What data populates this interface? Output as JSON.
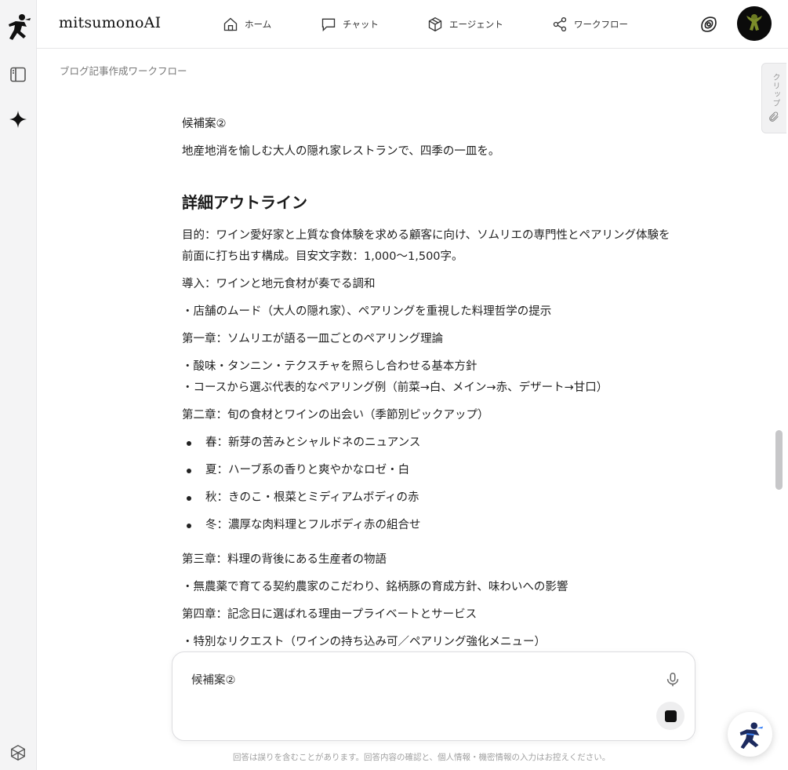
{
  "header": {
    "brand": "mitsumonoAI",
    "nav": [
      {
        "label": "ホーム",
        "icon": "home-icon"
      },
      {
        "label": "チャット",
        "icon": "chat-icon"
      },
      {
        "label": "エージェント",
        "icon": "box-icon"
      },
      {
        "label": "ワークフロー",
        "icon": "share-icon"
      }
    ]
  },
  "breadcrumb": "ブログ記事作成ワークフロー",
  "clip_tab": "クリップ",
  "content": {
    "candidate_label": "候補案②",
    "candidate_text": "地産地消を愉しむ大人の隠れ家レストランで、四季の一皿を。",
    "heading": "詳細アウトライン",
    "purpose_line1": "目的：ワイン愛好家と上質な食体験を求める顧客に向け、ソムリエの専門性とペアリング体験を",
    "purpose_line2": "前面に打ち出す構成。目安文字数：1,000〜1,500字。",
    "intro": "導入：ワインと地元食材が奏でる調和",
    "intro_item": "・店舗のムード（大人の隠れ家）、ペアリングを重視した料理哲学の提示",
    "ch1": "第一章：ソムリエが語る一皿ごとのペアリング理論",
    "ch1_item1": "・酸味・タンニン・テクスチャを照らし合わせる基本方針",
    "ch1_item2": "・コースから選ぶ代表的なペアリング例（前菜→白、メイン→赤、デザート→甘口）",
    "ch2": "第二章：旬の食材とワインの出会い（季節別ピックアップ）",
    "ch2_bullets": [
      "春：新芽の苦みとシャルドネのニュアンス",
      "夏：ハーブ系の香りと爽やかなロゼ・白",
      "秋：きのこ・根菜とミディアムボディの赤",
      "冬：濃厚な肉料理とフルボディ赤の組合せ"
    ],
    "ch3": "第三章：料理の背後にある生産者の物語",
    "ch3_item": "・無農薬で育てる契約農家のこだわり、銘柄豚の育成方針、味わいへの影響",
    "ch4": "第四章：記念日に選ばれる理由ープライベートとサービス",
    "ch4_item": "・特別なリクエスト（ワインの持ち込み可／ペアリング強化メニュー）"
  },
  "input": {
    "value": "候補案②"
  },
  "disclaimer": "回答は誤りを含むことがあります。回答内容の確認と、個人情報・機密情報の入力はお控えください。"
}
